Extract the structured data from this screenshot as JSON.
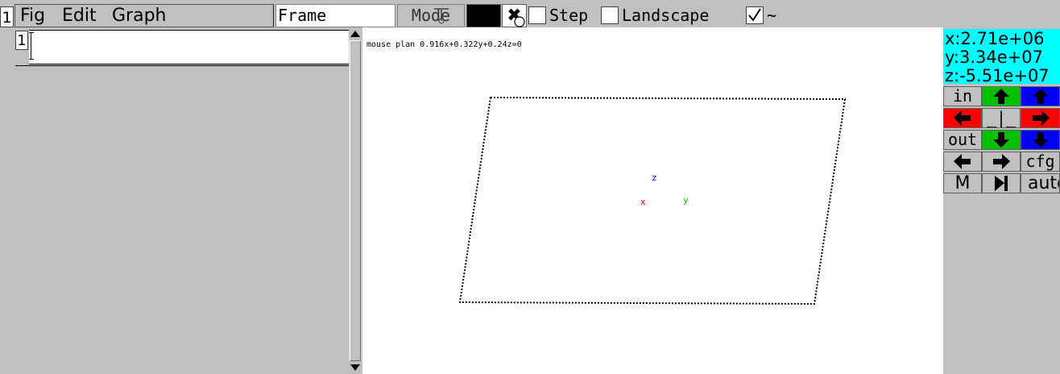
{
  "window": {
    "number": "1"
  },
  "menu": {
    "items": [
      "Fig",
      "Edit",
      "Graph"
    ]
  },
  "toolbar": {
    "frame_value": "Frame",
    "mode_label": "Mode",
    "color": "#000000",
    "close_label": "✖",
    "step_label": "Step",
    "step_checked": false,
    "landscape_label": "Landscape",
    "landscape_checked": false,
    "tilde_checked": true,
    "tilde_label": "~"
  },
  "editor": {
    "row_number": "1",
    "formula_value": ""
  },
  "canvas": {
    "mouse_plan": "mouse plan 0.916x+0.322y+0.24z=0",
    "axis_x": "x",
    "axis_y": "y",
    "axis_z": "z",
    "axis_colors": {
      "x": "#ff0000",
      "y": "#00c000",
      "z": "#0000ff"
    }
  },
  "coords": {
    "x": "x:2.71e+06",
    "y": "y:3.34e+07",
    "z": "z:-5.51e+07",
    "bg": "#00ffff"
  },
  "panel": {
    "in_label": "in",
    "out_label": "out",
    "cfg_label": "cfg",
    "m_label": "M",
    "auto_label": "auto",
    "center_label": "_|_",
    "colors": {
      "green": "#00c000",
      "blue": "#0000ff",
      "red": "#ff0000"
    }
  }
}
